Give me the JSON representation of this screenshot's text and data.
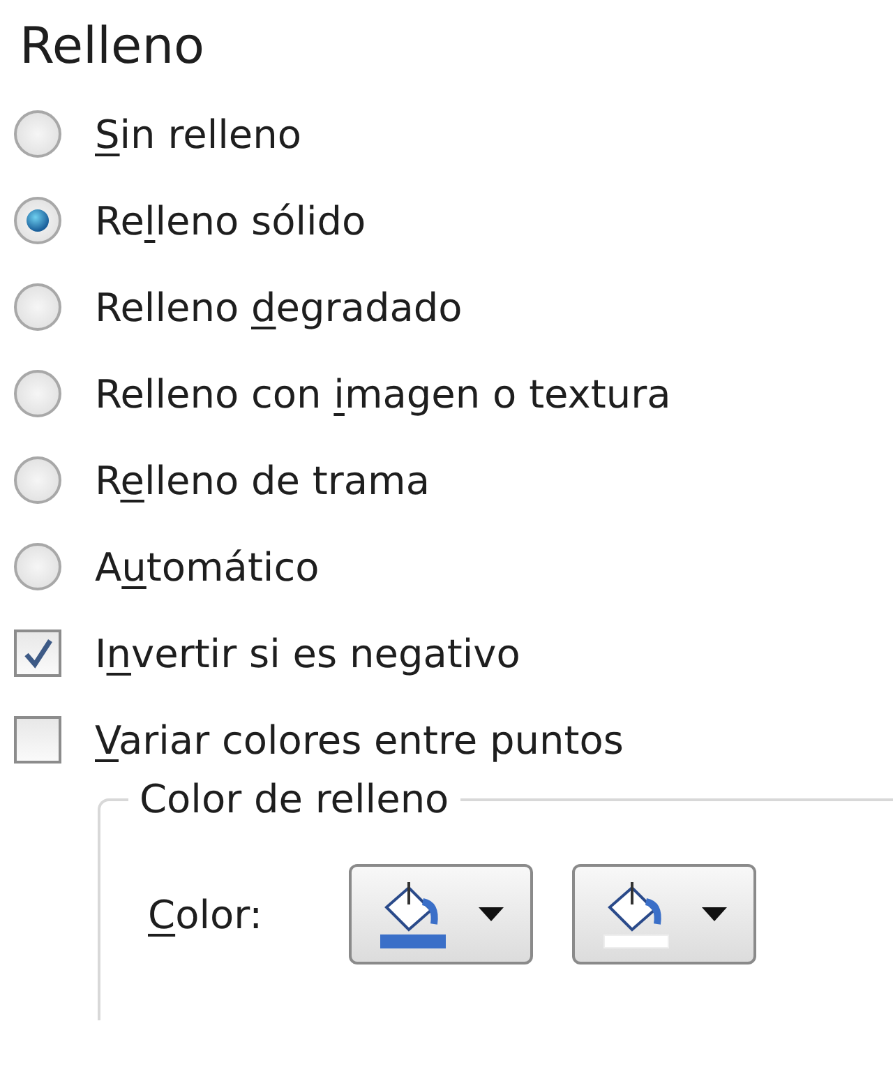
{
  "section_title": "Relleno",
  "options": [
    {
      "kind": "radio",
      "selected": false,
      "label": {
        "key": "S",
        "post": "in relleno"
      }
    },
    {
      "kind": "radio",
      "selected": true,
      "label": {
        "pre": "Re",
        "key": "l",
        "post": "leno sólido"
      }
    },
    {
      "kind": "radio",
      "selected": false,
      "label": {
        "pre": "Relleno ",
        "key": "d",
        "post": "egradado"
      }
    },
    {
      "kind": "radio",
      "selected": false,
      "label": {
        "pre": "Relleno con ",
        "key": "i",
        "post": "magen o textura"
      }
    },
    {
      "kind": "radio",
      "selected": false,
      "label": {
        "pre": "R",
        "key": "e",
        "post": "lleno de trama"
      }
    },
    {
      "kind": "radio",
      "selected": false,
      "label": {
        "pre": "A",
        "key": "u",
        "post": "tomático"
      }
    },
    {
      "kind": "checkbox",
      "checked": true,
      "label": {
        "pre": "I",
        "key": "n",
        "post": "vertir si es negativo"
      }
    },
    {
      "kind": "checkbox",
      "checked": false,
      "label": {
        "key": "V",
        "post": "ariar colores entre puntos"
      }
    }
  ],
  "fill_color_group": {
    "legend": "Color de relleno",
    "color_label": {
      "key": "C",
      "post": "olor:"
    },
    "color_buttons": [
      {
        "color": "#3a6fc8"
      },
      {
        "color": "#ffffff"
      }
    ]
  }
}
